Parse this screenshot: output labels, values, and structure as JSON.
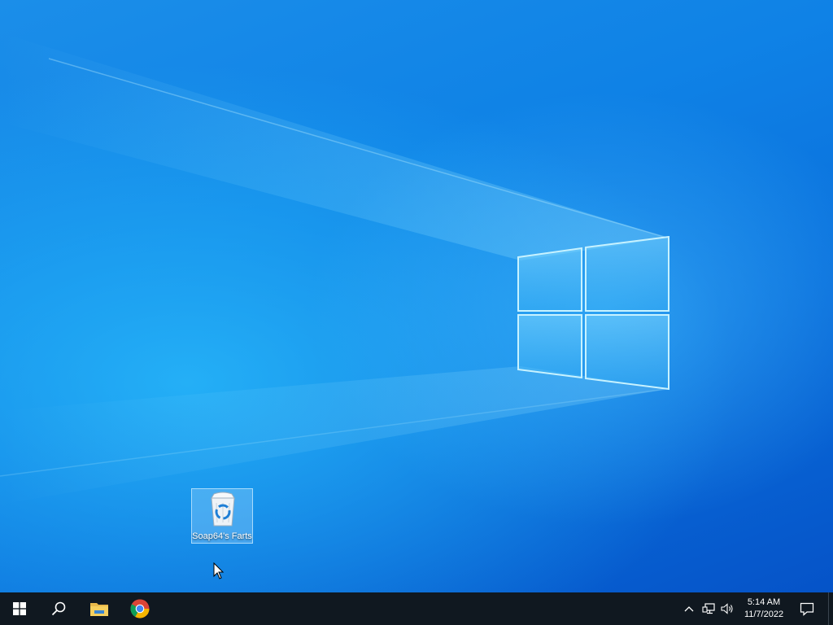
{
  "desktop": {
    "icons": [
      {
        "label": "Soap64's Farts",
        "icon": "recycle-bin-icon",
        "selected": true
      }
    ]
  },
  "taskbar": {
    "start": {
      "icon": "windows-start-icon"
    },
    "search": {
      "icon": "search-icon"
    },
    "pinned": [
      {
        "icon": "file-explorer-icon"
      },
      {
        "icon": "chrome-icon"
      }
    ],
    "tray": {
      "icons": [
        "chevron-up-icon",
        "network-icon",
        "volume-icon"
      ],
      "time": "5:14 AM",
      "date": "11/7/2022",
      "notification_icon": "action-center-icon"
    }
  },
  "colors": {
    "taskbar": "#101820",
    "desktop_accent": "#0f82e6"
  }
}
